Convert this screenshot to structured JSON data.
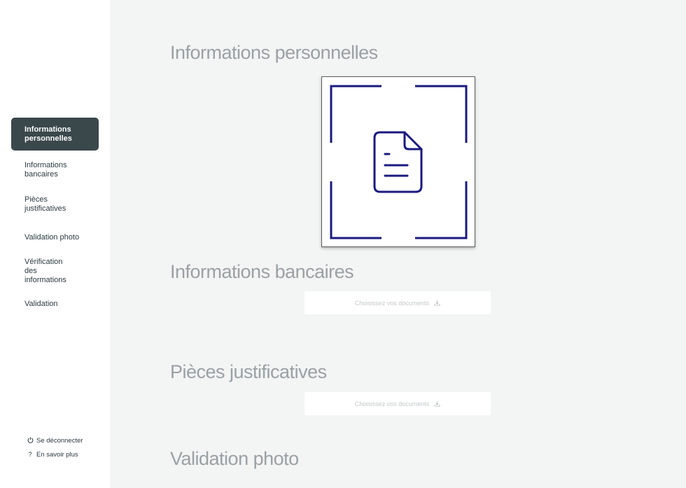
{
  "sidebar": {
    "items": [
      {
        "label": "Informations personnelles",
        "active": true
      },
      {
        "label": "Informations bancaires",
        "active": false
      },
      {
        "label": "Pièces justificatives",
        "active": false
      },
      {
        "label": "Validation photo",
        "active": false
      },
      {
        "label": "Vérification des informations",
        "active": false
      },
      {
        "label": "Validation",
        "active": false
      }
    ],
    "footer": {
      "logout": {
        "label": "Se déconnecter",
        "icon": "power-icon"
      },
      "learn_more": {
        "label": "En savoir plus",
        "icon": "question-icon"
      }
    }
  },
  "main": {
    "sections": [
      {
        "title": "Informations personnelles"
      },
      {
        "title": "Informations bancaires",
        "upload_label": "Choisissez vos documents",
        "upload_icon": "download-icon"
      },
      {
        "title": "Pièces justificatives",
        "upload_label": "Choisissez vos documents",
        "upload_icon": "download-icon"
      },
      {
        "title": "Validation photo"
      }
    ],
    "document_scan": {
      "icon": "document-icon",
      "frame_icon": "scan-frame-icon"
    }
  },
  "colors": {
    "accent": "#1a1a7e",
    "sidebar_active": "#3a474b",
    "background": "#f3f4f4",
    "section_title": "#9aa1a4"
  }
}
